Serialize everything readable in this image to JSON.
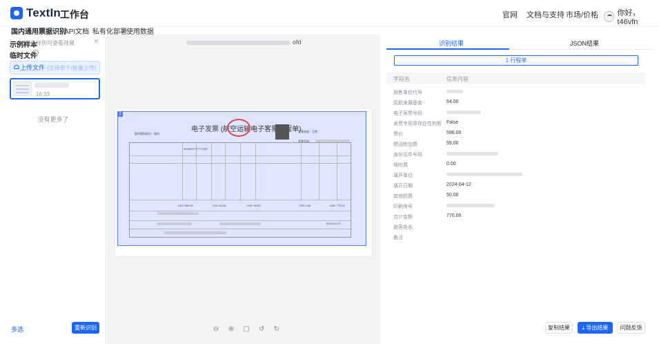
{
  "header": {
    "brand": "TextIn",
    "workspace": "工作台",
    "nav": [
      "官网",
      "文档与支持",
      "市场/价格"
    ],
    "user": "你好，t46vfn"
  },
  "subnav": {
    "items": [
      "国内通用票据识别",
      "API文档",
      "私有化部署",
      "使用数据"
    ]
  },
  "left": {
    "samples_title": "示例样本",
    "samples_hint": "*点击样例可查看效果",
    "close": "×",
    "temp_title": "临时文件",
    "info": "i",
    "upload_label": "上传文件",
    "upload_hint": "(支持单个/批量上传)",
    "thumb_time": "16:33",
    "no_more": "没有更多了",
    "multi_select": "多选",
    "rerun": "重新识别"
  },
  "center": {
    "file_ext": "ofd",
    "invoice": {
      "title": "电子发票",
      "title_sub": "(航空运输电子客票行程单)",
      "field_type": "国内国际标识：国内",
      "field_status": "发票状态：正常",
      "field_code": "发票号码：",
      "amount_1": "CNY 596.00",
      "amount_2": "CNY 64.00",
      "amount_3": "CNY 59.00",
      "amount_4": "CNY 0.00",
      "amount_5": "CNY 770.00",
      "date": "2024-04-12",
      "seq": "5105037*******1397"
    },
    "zoom_icons": [
      "⊖",
      "⊕",
      "▢",
      "↺",
      "↻"
    ]
  },
  "right": {
    "tab_result": "识别结果",
    "tab_json": "JSON结果",
    "table_pill": "1 行程单",
    "col_field": "字段名",
    "col_value": "信息内容",
    "rows": [
      {
        "label": "销售单位代号",
        "value": ""
      },
      {
        "label": "民航发展基金",
        "value": "64.00"
      },
      {
        "label": "电子客票号码",
        "value": ""
      },
      {
        "label": "发票专用章存在性判断",
        "value": "False"
      },
      {
        "label": "票价",
        "value": "596.00"
      },
      {
        "label": "燃油附加费",
        "value": "59.00"
      },
      {
        "label": "身份证件号码",
        "value": ""
      },
      {
        "label": "保险费",
        "value": "0.00"
      },
      {
        "label": "填开单位",
        "value": ""
      },
      {
        "label": "填开日期",
        "value": "2024-04-12"
      },
      {
        "label": "其他税费",
        "value": "50.00"
      },
      {
        "label": "印刷序号",
        "value": ""
      },
      {
        "label": "合计金额",
        "value": "770.00"
      },
      {
        "label": "旅客姓名",
        "value": ""
      },
      {
        "label": "备注",
        "value": ""
      }
    ],
    "copy_btn": "复制结果",
    "export_btn": "导出结果",
    "feedback_btn": "问题反馈"
  }
}
